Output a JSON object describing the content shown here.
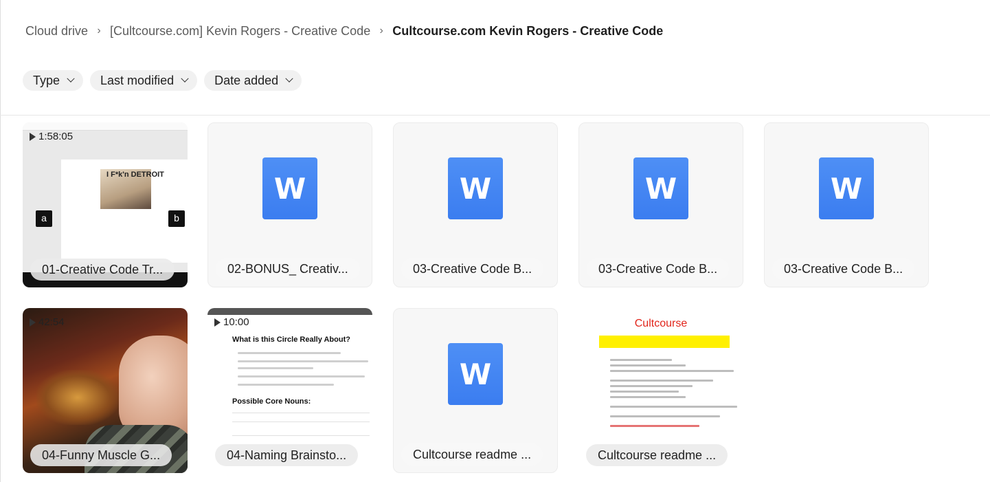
{
  "breadcrumb": {
    "items": [
      "Cloud drive",
      "[Cultcourse.com] Kevin Rogers - Creative Code"
    ],
    "current": "Cultcourse.com Kevin Rogers - Creative Code",
    "separator_icon": "chevron-right-icon"
  },
  "filters": [
    {
      "label": "Type",
      "icon": "chevron-down-icon"
    },
    {
      "label": "Last modified",
      "icon": "chevron-down-icon"
    },
    {
      "label": "Date added",
      "icon": "chevron-down-icon"
    }
  ],
  "files": [
    {
      "name": "01-Creative Code Tr...",
      "kind": "video",
      "duration": "1:58:05"
    },
    {
      "name": "02-BONUS_ Creativ...",
      "kind": "word",
      "icon_letter": "W"
    },
    {
      "name": "03-Creative Code B...",
      "kind": "word",
      "icon_letter": "W"
    },
    {
      "name": "03-Creative Code B...",
      "kind": "word",
      "icon_letter": "W"
    },
    {
      "name": "03-Creative Code B...",
      "kind": "word",
      "icon_letter": "W"
    },
    {
      "name": "04-Funny Muscle G...",
      "kind": "video",
      "duration": "42:54"
    },
    {
      "name": "04-Naming Brainsto...",
      "kind": "video",
      "duration": "10:00"
    },
    {
      "name": "Cultcourse readme ...",
      "kind": "word",
      "icon_letter": "W"
    },
    {
      "name": "Cultcourse readme ...",
      "kind": "document",
      "thumb_title": "Cultcourse"
    }
  ],
  "thumb_text": {
    "detroit": "I F*k'n DETROIT",
    "avatar_a": "a",
    "avatar_b": "b",
    "doc_heading1": "What is this Circle Really About?",
    "doc_heading2": "Possible Core Nouns:"
  },
  "colors": {
    "word_icon": "#3b7df0",
    "readme_title": "#e1251b",
    "highlight": "#fff000"
  }
}
